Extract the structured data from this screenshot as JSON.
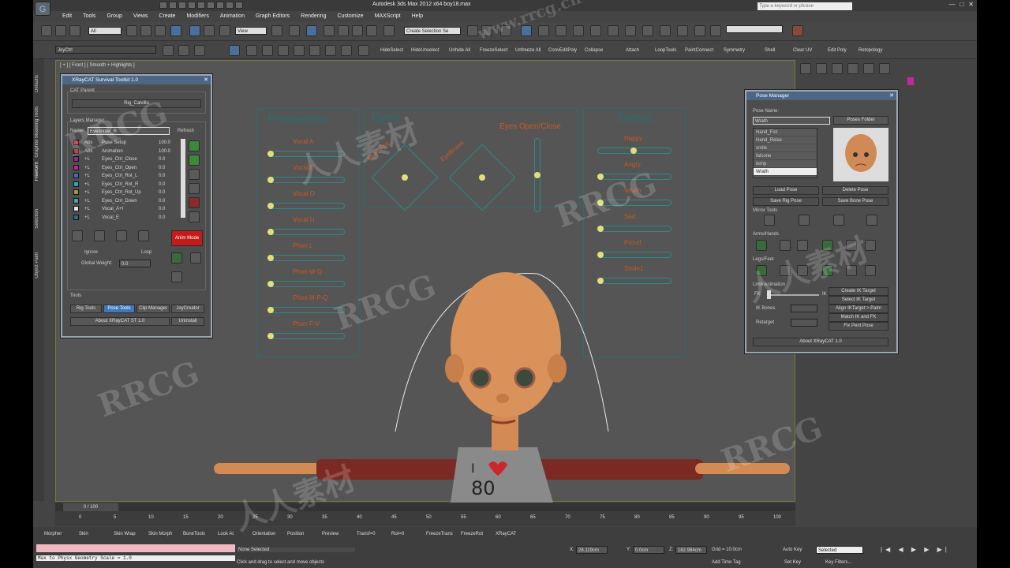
{
  "title": "Autodesk 3ds Max 2012 x64     boy18.max",
  "search_placeholder": "Type a keyword or phrase",
  "menu": [
    "Edit",
    "Tools",
    "Group",
    "Views",
    "Create",
    "Modifiers",
    "Animation",
    "Graph Editors",
    "Rendering",
    "Customize",
    "MAXScript",
    "Help"
  ],
  "toolbar": {
    "filter": "All",
    "view": "View",
    "selection_set": "Create Selection Se",
    "joyctrl": "JoyCtrl",
    "axes": [
      "X",
      "Y",
      "Z",
      "XY"
    ]
  },
  "toolbar2": [
    "HideSelect",
    "HideUnselect",
    "Unhide All",
    "FreezeSelect",
    "Unfreeze All",
    "ConvEditPoly",
    "Collapse",
    "Attach",
    "LoopTools",
    "PaintConnect",
    "Symmetry",
    "Shell",
    "Clear UV",
    "Edit Poly",
    "Retopology"
  ],
  "side_tabs": [
    "Defaults",
    "Graphite Modeling Tools",
    "Freeform",
    "Selection",
    "Object Paint"
  ],
  "viewport_label": "[ + ] [ Front ] [ Smooth + Highlights ]",
  "rig": {
    "phonemes_title": "Phonemes",
    "eyes_title": "Eyes",
    "status_title": "Status",
    "phonemes": [
      "Vocal A",
      "Vocal E",
      "Vocal O",
      "Vocal U",
      "Phon L",
      "Phon W-Q",
      "Phon M-P-Q",
      "Phon F-V"
    ],
    "eye_labels": {
      "rot": "Eyes Rot",
      "brows": "EyeBrows",
      "open": "Eyes Open/Close"
    },
    "status": [
      "Happy",
      "Angry",
      "Wrath",
      "Sad",
      "Proud",
      "Smile1"
    ]
  },
  "toolkit": {
    "title": "XRayCAT Survival Toolkit 1.0",
    "cat_parent": "CAT Parent",
    "rig_btn": "Rig_Calvillo",
    "layers_manager": "Layers Manager",
    "name_label": "Name:",
    "name_value": "Eyesbrow_R",
    "refresh": "Refresh",
    "layers": [
      {
        "t": "Abs",
        "n": "Pose Setup",
        "v": "100.0",
        "c": "#c8282d"
      },
      {
        "t": "Abs",
        "n": "Animation",
        "v": "100.0",
        "c": "#b31c1c"
      },
      {
        "t": "+L",
        "n": "Eyes_Ctrl_Close",
        "v": "0.0",
        "c": "#8f2a8f"
      },
      {
        "t": "+L",
        "n": "Eyes_Ctrl_Open",
        "v": "0.0",
        "c": "#c22090"
      },
      {
        "t": "+L",
        "n": "Eyes_Ctrl_Rot_L",
        "v": "0.0",
        "c": "#4a6ac2"
      },
      {
        "t": "+L",
        "n": "Eyes_Ctrl_Rot_R",
        "v": "0.0",
        "c": "#2aa8c0"
      },
      {
        "t": "+L",
        "n": "Eyes_Ctrl_Rot_Up",
        "v": "0.0",
        "c": "#a0953a"
      },
      {
        "t": "+L",
        "n": "Eyes_Ctrl_Down",
        "v": "0.0",
        "c": "#4aa8a2"
      },
      {
        "t": "+L",
        "n": "Vocal_A+I",
        "v": "0.0",
        "c": "#e6e6e6"
      },
      {
        "t": "+L",
        "n": "Vocal_E",
        "v": "0.0",
        "c": "#2a6a8a"
      }
    ],
    "anim_mode": "Anim Mode",
    "ignore": "Ignore",
    "loop": "Loop",
    "global_weight": "Global Weight:",
    "weight_value": "0.0",
    "tools_label": "Tools",
    "tools": [
      "Rig Tools",
      "Pose Tools",
      "Clip Manager",
      "JoyCreator"
    ],
    "about": "About XRayCAT ST 1.0",
    "uninstall": "Uninstall"
  },
  "pose": {
    "title": "Pose Manager",
    "pose_name_label": "Pose Name:",
    "pose_name": "Wrath",
    "poses_folder": "Poses Folder",
    "list": [
      "Hand_Fist",
      "Hand_Relax",
      "smile",
      "falcone",
      "temp",
      "Wrath"
    ],
    "load": "Load Pose",
    "delete": "Delete Pose",
    "save_rig": "Save Rig Pose",
    "save_bone": "Save Bone Pose",
    "mirror": "Mirror Tools",
    "arms": "Arms/Hands",
    "legs": "Legs/Feet",
    "limb": "Limb Animation",
    "fk": "FK",
    "ik": "IK",
    "limb_buttons": [
      "Create IK Target",
      "Select IK Target",
      "Align IKTarget > Palm",
      "Match IK and FK",
      "Fix Pent Pose"
    ],
    "ik_bones": "IK Bones",
    "retarget": "Retarget",
    "about": "About XRayCAT 1.0"
  },
  "timeline": {
    "frame": "0 / 100",
    "ticks": [
      "0",
      "5",
      "10",
      "15",
      "20",
      "25",
      "30",
      "35",
      "40",
      "45",
      "50",
      "55",
      "60",
      "65",
      "70",
      "75",
      "80",
      "85",
      "90",
      "95",
      "100"
    ]
  },
  "bottom": {
    "tools": [
      "Morpher",
      "Skin",
      "Skin Wrap",
      "Skin Morph",
      "BoneTools",
      "Look At",
      "Orientation",
      "Position",
      "Preview",
      "Transf=0",
      "Rot=0",
      "FreezeTrans",
      "FreezeRot",
      "XRayCAT"
    ],
    "script_line": "Max to Physx Geometry Scale = 1.0",
    "none_selected": "None Selected",
    "hint": "Click and drag to select and move objects",
    "x": "28.119cm",
    "y": "0.0cm",
    "z": "182.984cm",
    "grid": "Grid = 10.0cm",
    "add_time_tag": "Add Time Tag",
    "auto_key": "Auto Key",
    "selected": "Selected",
    "set_key": "Set Key",
    "key_filters": "Key Filters..."
  },
  "watermarks": [
    "RRCG",
    "人人素材",
    "www.rrcg.cn"
  ]
}
